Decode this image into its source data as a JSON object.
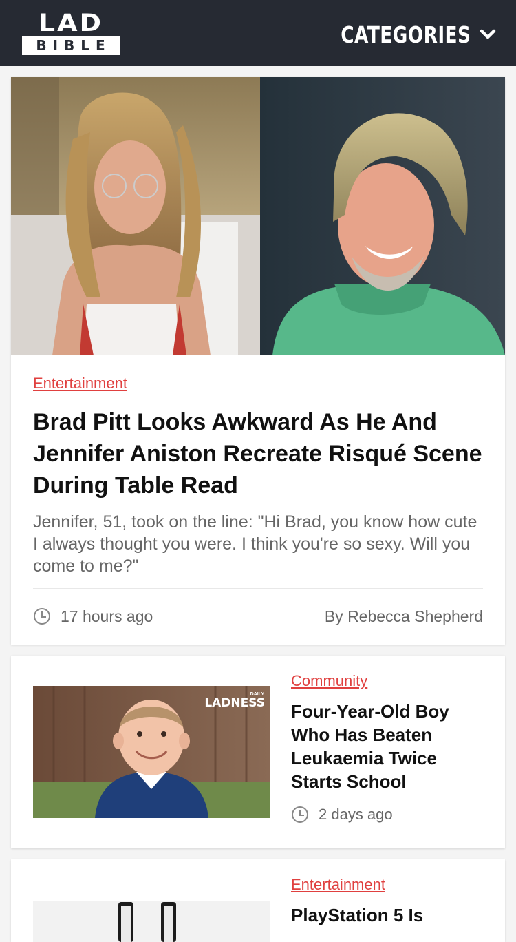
{
  "header": {
    "logo_top": "LAD",
    "logo_bottom": "BIBLE",
    "categories_label": "CATEGORIES"
  },
  "featured": {
    "category": "Entertainment",
    "title": "Brad Pitt Looks Awkward As He And Jennifer Aniston Recreate Risqué Scene During Table Read",
    "description": "Jennifer, 51, took on the line: \"Hi Brad, you know how cute I always thought you were. I think you're so sexy. Will you come to me?\"",
    "time": "17 hours ago",
    "author": "By Rebecca Shepherd"
  },
  "articles": [
    {
      "category": "Community",
      "title": "Four-Year-Old Boy Who Has Beaten Leukaemia Twice Starts School",
      "time": "2 days ago",
      "thumb_watermark_small": "DAILY",
      "thumb_watermark": "LADNESS"
    },
    {
      "category": "Entertainment",
      "title": "PlayStation 5 Is"
    }
  ],
  "colors": {
    "header_bg": "#262a33",
    "accent": "#e0403f",
    "text": "#111111",
    "muted": "#666666"
  },
  "icons": [
    "chevron-down-icon",
    "clock-icon"
  ]
}
